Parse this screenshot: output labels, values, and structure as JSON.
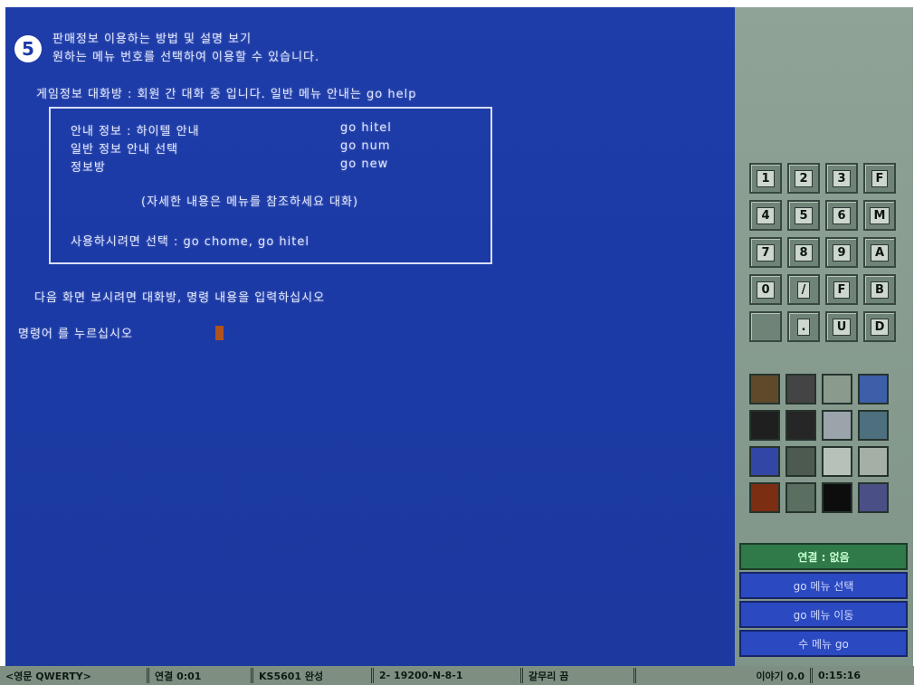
{
  "terminal": {
    "step_number": "5",
    "intro_line1": "판매정보 이용하는 방법 및 설명 보기",
    "intro_line2": "원하는 메뉴 번호를 선택하여 이용할 수 있습니다.",
    "guide_line": "게임정보 대화방 : 회원 간 대화 중 입니다. 일반 메뉴 안내는 go help",
    "menu": [
      {
        "label": "안내 정보 : 하이텔 안내",
        "cmd": "go hitel"
      },
      {
        "label": "      일반 정보 안내 선택",
        "cmd": "go num"
      },
      {
        "label": "      정보방",
        "cmd": "go new"
      }
    ],
    "menu_note": "(자세한 내용은 메뉴를 참조하세요 대화)",
    "menu_footer": "사용하시려면 선택 : go chome, go hitel",
    "bottom_hint": "다음 화면 보시려면 대화방, 명령 내용을 입력하십시오",
    "prompt": "명령어 를 누르십시오"
  },
  "keypad": {
    "keys": [
      "1",
      "2",
      "3",
      "F",
      "4",
      "5",
      "6",
      "M",
      "7",
      "8",
      "9",
      "A",
      "0",
      "/",
      "F",
      "B",
      "",
      ".",
      "U",
      "D"
    ]
  },
  "icons": [
    {
      "name": "door-icon",
      "bg": "#5e4a2b"
    },
    {
      "name": "face-icon",
      "bg": "#444444"
    },
    {
      "name": "camera-icon",
      "bg": "#8a9a8c"
    },
    {
      "name": "screen-icon",
      "bg": "#3d5ea8"
    },
    {
      "name": "dark-door-icon",
      "bg": "#1f1f1f"
    },
    {
      "name": "dark-box-icon",
      "bg": "#262626"
    },
    {
      "name": "portrait-icon",
      "bg": "#9aa4aa"
    },
    {
      "name": "sky-icon",
      "bg": "#4d6f7e"
    },
    {
      "name": "blue-screen-icon",
      "bg": "#3247a5"
    },
    {
      "name": "panel-icon",
      "bg": "#4c5a4f"
    },
    {
      "name": "list-icon",
      "bg": "#b6c2b9"
    },
    {
      "name": "grid-icon",
      "bg": "#a4b0a6"
    },
    {
      "name": "fire-icon",
      "bg": "#7b2e12"
    },
    {
      "name": "chart-icon",
      "bg": "#5a6f60"
    },
    {
      "name": "black-square-icon",
      "bg": "#0d0d0d"
    },
    {
      "name": "flag-icon",
      "bg": "#4a4f86"
    }
  ],
  "panel": {
    "status_chip": "연결 : 없음",
    "go_buttons": [
      "go 메뉴 선택",
      "go 메뉴 이동",
      "수 메뉴 go"
    ]
  },
  "statusbar": {
    "mode": "<영문 QWERTY>",
    "connect": "연결 0:01",
    "terminal": "KS5601 완성",
    "speed": "2- 19200-N-8-1",
    "capture": "갈무리 끔",
    "time_label": "이야기 0.0",
    "clock": "0:15:16"
  },
  "colors": {
    "terminal_bg": "#1c3aa6",
    "panel_bg": "#8a9e91",
    "statusbar_bg": "#7e8f82"
  }
}
